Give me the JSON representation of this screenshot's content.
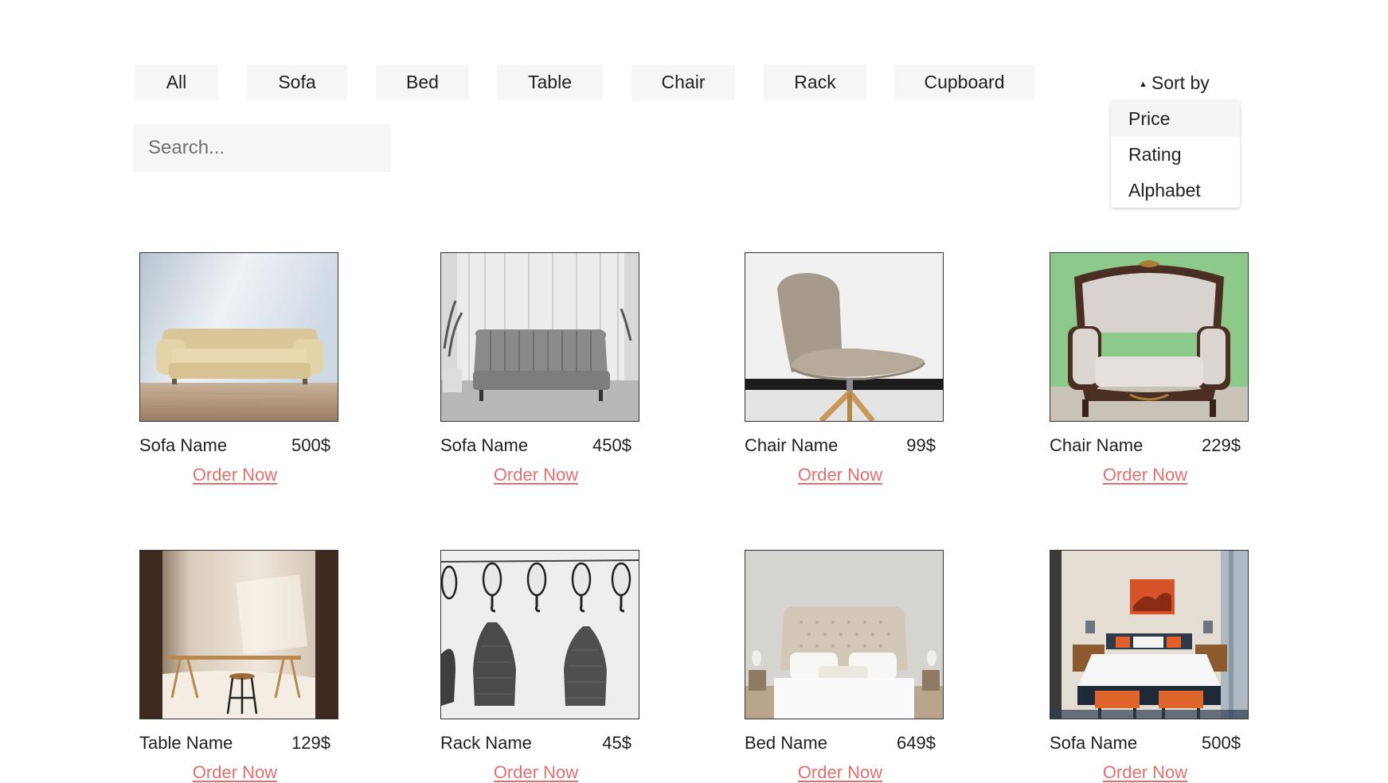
{
  "filters": [
    "All",
    "Sofa",
    "Bed",
    "Table",
    "Chair",
    "Rack",
    "Cupboard"
  ],
  "sort": {
    "label": "Sort by",
    "caret": "▲",
    "options": [
      "Price",
      "Rating",
      "Alphabet"
    ],
    "highlighted": "Price"
  },
  "search": {
    "placeholder": "Search...",
    "value": "",
    "icon": "search-icon"
  },
  "colors": {
    "accent_link": "#e0706f",
    "button_bg": "#f6f6f6",
    "text": "#1f1f1f"
  },
  "products": [
    {
      "name": "Sofa Name",
      "price": "500$",
      "action": "Order Now",
      "image": "beige-sofa"
    },
    {
      "name": "Sofa Name",
      "price": "450$",
      "action": "Order Now",
      "image": "gray-channel-sofa"
    },
    {
      "name": "Chair Name",
      "price": "99$",
      "action": "Order Now",
      "image": "swivel-chair"
    },
    {
      "name": "Chair Name",
      "price": "229$",
      "action": "Order Now",
      "image": "baroque-armchair"
    },
    {
      "name": "Table Name",
      "price": "129$",
      "action": "Order Now",
      "image": "wooden-table"
    },
    {
      "name": "Rack Name",
      "price": "45$",
      "action": "Order Now",
      "image": "hat-rack"
    },
    {
      "name": "Bed Name",
      "price": "649$",
      "action": "Order Now",
      "image": "tufted-bed"
    },
    {
      "name": "Sofa Name",
      "price": "500$",
      "action": "Order Now",
      "image": "bedroom-set"
    }
  ]
}
